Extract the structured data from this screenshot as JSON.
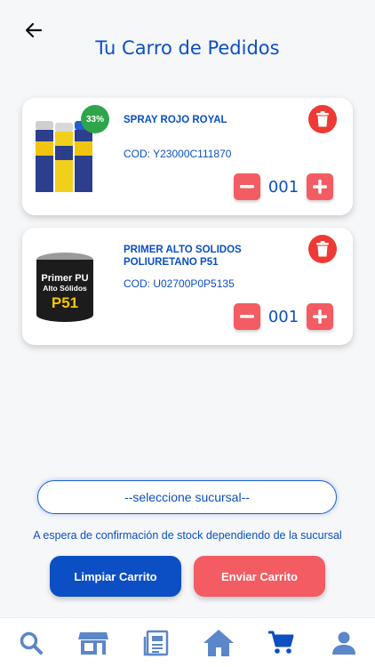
{
  "header": {
    "title": "Tu Carro de Pedidos"
  },
  "cart": {
    "items": [
      {
        "name": "SPRAY ROJO ROYAL",
        "code": "COD: Y23000C111870",
        "quantity": "001",
        "discount": "33%"
      },
      {
        "name": "PRIMER ALTO SOLIDOS POLIURETANO P51",
        "code": "COD: U02700P0P5135",
        "quantity": "001"
      }
    ]
  },
  "branch": {
    "placeholder": "--seleccione sucursal--"
  },
  "notice": "A espera de confirmación de stock dependiendo de la sucursal",
  "actions": {
    "clear_label": "Limpiar Carrito",
    "send_label": "Enviar Carrito"
  },
  "colors": {
    "primary": "#0b4fc2",
    "accent": "#f35c62",
    "delete": "#ee3a34",
    "discount": "#2fa44b"
  },
  "bottom_nav": [
    "search-icon",
    "store-icon",
    "catalog-icon",
    "home-icon",
    "cart-icon",
    "profile-icon"
  ]
}
